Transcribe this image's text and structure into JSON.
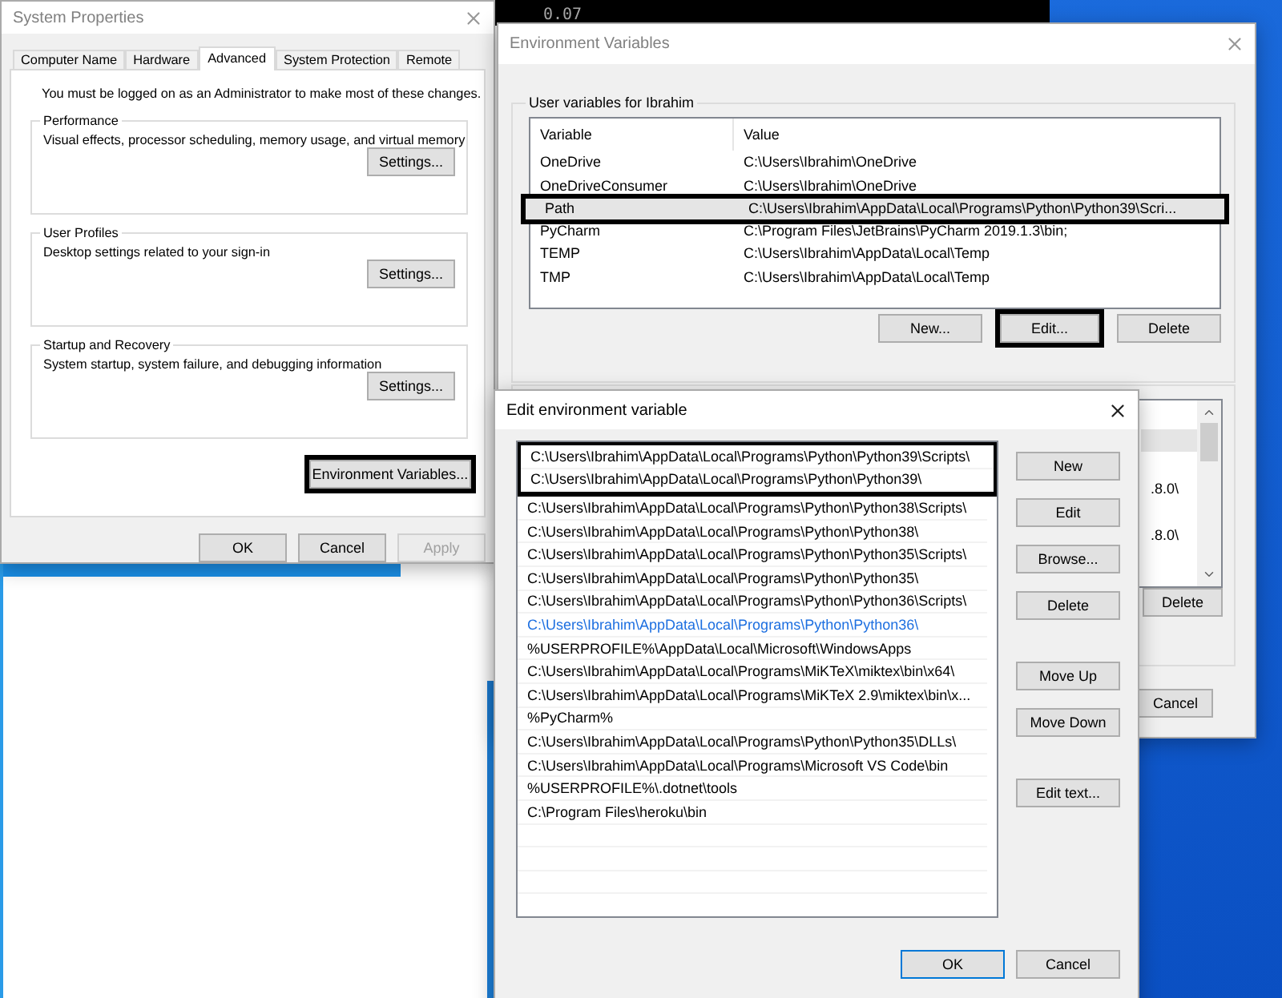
{
  "background_app": {
    "selected_row": {
      "selected": true
    }
  },
  "terminal": {
    "text": "0.07"
  },
  "system_properties": {
    "title": "System Properties",
    "tabs": [
      {
        "label": "Computer Name",
        "selected": false
      },
      {
        "label": "Hardware",
        "selected": false
      },
      {
        "label": "Advanced",
        "selected": true
      },
      {
        "label": "System Protection",
        "selected": false
      },
      {
        "label": "Remote",
        "selected": false
      }
    ],
    "note": "You must be logged on as an Administrator to make most of these changes.",
    "groups": [
      {
        "legend": "Performance",
        "description": "Visual effects, processor scheduling, memory usage, and virtual memory",
        "button": "Settings..."
      },
      {
        "legend": "User Profiles",
        "description": "Desktop settings related to your sign-in",
        "button": "Settings..."
      },
      {
        "legend": "Startup and Recovery",
        "description": "System startup, system failure, and debugging information",
        "button": "Settings..."
      }
    ],
    "env_button": {
      "label": "Environment Variables...",
      "highlighted": true
    },
    "buttons": [
      {
        "label": "OK",
        "disabled": false
      },
      {
        "label": "Cancel",
        "disabled": false
      },
      {
        "label": "Apply",
        "disabled": true
      }
    ]
  },
  "environment_variables": {
    "title": "Environment Variables",
    "user_group": {
      "legend": "User variables for Ibrahim",
      "columns": [
        "Variable",
        "Value"
      ],
      "rows": [
        {
          "variable": "OneDrive",
          "value": "C:\\Users\\Ibrahim\\OneDrive",
          "selected": false,
          "highlighted": false
        },
        {
          "variable": "OneDriveConsumer",
          "value": "C:\\Users\\Ibrahim\\OneDrive",
          "selected": false,
          "highlighted": false
        },
        {
          "variable": "Path",
          "value": "C:\\Users\\Ibrahim\\AppData\\Local\\Programs\\Python\\Python39\\Scri...",
          "selected": true,
          "highlighted": true
        },
        {
          "variable": "PyCharm",
          "value": "C:\\Program Files\\JetBrains\\PyCharm 2019.1.3\\bin;",
          "selected": false,
          "highlighted": false
        },
        {
          "variable": "TEMP",
          "value": "C:\\Users\\Ibrahim\\AppData\\Local\\Temp",
          "selected": false,
          "highlighted": false
        },
        {
          "variable": "TMP",
          "value": "C:\\Users\\Ibrahim\\AppData\\Local\\Temp",
          "selected": false,
          "highlighted": false
        }
      ],
      "buttons": [
        {
          "label": "New...",
          "highlighted": false
        },
        {
          "label": "Edit...",
          "highlighted": true
        },
        {
          "label": "Delete",
          "highlighted": false
        }
      ]
    },
    "system_group": {
      "rows": [
        {
          "selected": true
        },
        {
          "selected": false,
          "value": ".8.0\\"
        },
        {
          "selected": false,
          "value": ".8.0\\"
        }
      ],
      "buttons": [
        "Delete"
      ]
    },
    "buttons": [
      "Cancel"
    ]
  },
  "edit_variable": {
    "title": "Edit environment variable",
    "entries": [
      {
        "kind": "path",
        "text": "C:\\Users\\Ibrahim\\AppData\\Local\\Programs\\Python\\Python39\\Scripts\\",
        "highlighted": true
      },
      {
        "kind": "path",
        "text": "C:\\Users\\Ibrahim\\AppData\\Local\\Programs\\Python\\Python39\\",
        "highlighted": true
      },
      {
        "kind": "path",
        "text": "C:\\Users\\Ibrahim\\AppData\\Local\\Programs\\Python\\Python38\\Scripts\\",
        "highlighted": false
      },
      {
        "kind": "path",
        "text": "C:\\Users\\Ibrahim\\AppData\\Local\\Programs\\Python\\Python38\\",
        "highlighted": false
      },
      {
        "kind": "path",
        "text": "C:\\Users\\Ibrahim\\AppData\\Local\\Programs\\Python\\Python35\\Scripts\\",
        "highlighted": false
      },
      {
        "kind": "path",
        "text": "C:\\Users\\Ibrahim\\AppData\\Local\\Programs\\Python\\Python35\\",
        "highlighted": false
      },
      {
        "kind": "path",
        "text": "C:\\Users\\Ibrahim\\AppData\\Local\\Programs\\Python\\Python36\\Scripts\\",
        "highlighted": false
      },
      {
        "kind": "editing",
        "text": "C:\\Users\\Ibrahim\\AppData\\Local\\Programs\\Python\\Python36\\",
        "highlighted": false
      },
      {
        "kind": "path",
        "text": "%USERPROFILE%\\AppData\\Local\\Microsoft\\WindowsApps",
        "highlighted": false
      },
      {
        "kind": "path",
        "text": "C:\\Users\\Ibrahim\\AppData\\Local\\Programs\\MiKTeX\\miktex\\bin\\x64\\",
        "highlighted": false
      },
      {
        "kind": "path",
        "text": "C:\\Users\\Ibrahim\\AppData\\Local\\Programs\\MiKTeX 2.9\\miktex\\bin\\x...",
        "highlighted": false
      },
      {
        "kind": "path",
        "text": "%PyCharm%",
        "highlighted": false
      },
      {
        "kind": "path",
        "text": "C:\\Users\\Ibrahim\\AppData\\Local\\Programs\\Python\\Python35\\DLLs\\",
        "highlighted": false
      },
      {
        "kind": "path",
        "text": "C:\\Users\\Ibrahim\\AppData\\Local\\Programs\\Microsoft VS Code\\bin",
        "highlighted": false
      },
      {
        "kind": "path",
        "text": "%USERPROFILE%\\.dotnet\\tools",
        "highlighted": false
      },
      {
        "kind": "path",
        "text": "C:\\Program Files\\heroku\\bin",
        "highlighted": false
      }
    ],
    "button_groups": [
      [
        "New",
        "Edit",
        "Browse...",
        "Delete"
      ],
      [
        "Move Up",
        "Move Down"
      ],
      [
        "Edit text..."
      ]
    ],
    "footer_buttons": [
      {
        "label": "OK",
        "default": true
      },
      {
        "label": "Cancel",
        "default": false
      }
    ]
  }
}
